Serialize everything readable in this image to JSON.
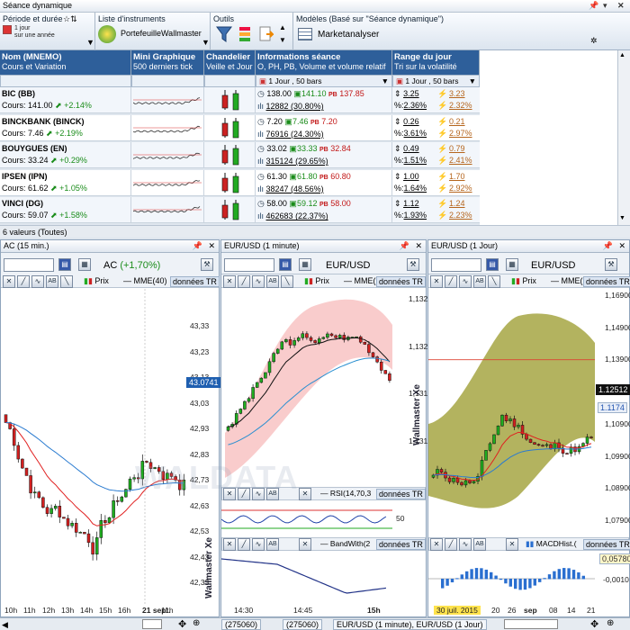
{
  "window": {
    "title": "Séance dynamique"
  },
  "toolbar": {
    "period_title": "Période et durée",
    "period_value1": "1 jour",
    "period_value2": "sur une année",
    "list_title": "Liste d'instruments",
    "list_value": "PortefeuilleWallmaster",
    "tools_title": "Outils",
    "models_title": "Modèles (Basé sur \"Séance dynamique\")",
    "models_value": "Marketanalyser"
  },
  "columns": [
    {
      "title": "Nom (MNEMO)",
      "sub": "Cours et Variation"
    },
    {
      "title": "Mini Graphique",
      "sub": "500 derniers tick"
    },
    {
      "title": "Chandelier",
      "sub": "Veille et Jour"
    },
    {
      "title": "Informations séance",
      "sub": "O, PH, PB, Volume et volume relatif"
    },
    {
      "title": "Range du jour",
      "sub": "Tri sur la volatilité"
    }
  ],
  "col_period": "1 Jour , 50 bars",
  "rows": [
    {
      "name": "BIC (BB)",
      "price": "Cours: 141.00",
      "chg": "+2.14%",
      "o": "138.00",
      "ph": "141.10",
      "pb": "137.85",
      "vol": "12882 (30.80%)",
      "r1": "3.25",
      "r2": "3.23",
      "p1": "2.36%",
      "p2": "2.32%"
    },
    {
      "name": "BINCKBANK (BINCK)",
      "price": "Cours: 7.46",
      "chg": "+2.19%",
      "o": "7.20",
      "ph": "7.46",
      "pb": "7.20",
      "vol": "76916 (24.30%)",
      "r1": "0.26",
      "r2": "0.21",
      "p1": "3.61%",
      "p2": "2.97%"
    },
    {
      "name": "BOUYGUES (EN)",
      "price": "Cours: 33.24",
      "chg": "+0.29%",
      "o": "33.02",
      "ph": "33.33",
      "pb": "32.84",
      "vol": "315124 (29.65%)",
      "r1": "0.49",
      "r2": "0.79",
      "p1": "1.51%",
      "p2": "2.41%"
    },
    {
      "name": "IPSEN (IPN)",
      "price": "Cours: 61.62",
      "chg": "+1.05%",
      "o": "61.30",
      "ph": "61.80",
      "pb": "60.80",
      "vol": "38247 (48.56%)",
      "r1": "1.00",
      "r2": "1.70",
      "p1": "1.64%",
      "p2": "2.92%"
    },
    {
      "name": "VINCI (DG)",
      "price": "Cours: 59.07",
      "chg": "+1.58%",
      "o": "58.00",
      "ph": "59.12",
      "pb": "58.00",
      "vol": "462683 (22.37%)",
      "r1": "1.12",
      "r2": "1.24",
      "p1": "1.93%",
      "p2": "2.23%"
    }
  ],
  "pb_label": "PB",
  "pct_label": "%:",
  "status": "6 valeurs (Toutes)",
  "panels": [
    {
      "title": "AC (15 min.)",
      "symbol": "AC",
      "chg": "(+1,70%)",
      "legend1": "Prix",
      "legend2": "MME(40)",
      "data_tag": "données TR",
      "yticks": [
        "43,33",
        "43,23",
        "43,13",
        "43,03",
        "42,93",
        "42,83",
        "42,73",
        "42,63",
        "42,53",
        "42,43",
        "42,33"
      ],
      "last": "43.0741",
      "xticks": [
        "10h",
        "11h",
        "12h",
        "13h",
        "14h",
        "15h",
        "16h",
        "21 sept.",
        "11h"
      ]
    },
    {
      "title": "EUR/USD (1 minute)",
      "symbol": "EUR/USD",
      "legend1": "Prix",
      "legend2": "MME(",
      "data_tag": "données TR",
      "yticks": [
        "1,13290",
        "1,13240",
        "1,13190",
        "1,13140"
      ],
      "rsi": "RSI(14,70,3",
      "rsi_val": "50",
      "bw": "BandWith(2",
      "xticks": [
        "14:30",
        "14:45",
        "15h"
      ]
    },
    {
      "title": "EUR/USD (1 Jour)",
      "symbol": "EUR/USD",
      "legend1": "Prix",
      "legend2": "MME(",
      "data_tag": "données TR",
      "yticks": [
        "1,16900",
        "1,14900",
        "1,13900",
        "1,11900",
        "1,10900",
        "1,09900",
        "1,08900",
        "1,07900"
      ],
      "last": "1.12512",
      "last2": "1.1174",
      "macd": "MACDHist.(",
      "macd_val": "0,05780",
      "macd_tick": "-0,0010",
      "xticks": [
        "30 juil. 2015",
        "20",
        "26",
        "sep",
        "08",
        "14",
        "21"
      ]
    }
  ],
  "watermark": "WALDATA",
  "vertical_brand": "Wallmaster Xe",
  "bottom_tabs": [
    "(275060)",
    "(275060)",
    "EUR/USD (1 minute), EUR/USD (1 Jour)"
  ],
  "colors": {
    "header": "#2e5f9a",
    "up": "#1a8c1a",
    "down": "#c21818",
    "cloud": "#9a9a2a"
  }
}
